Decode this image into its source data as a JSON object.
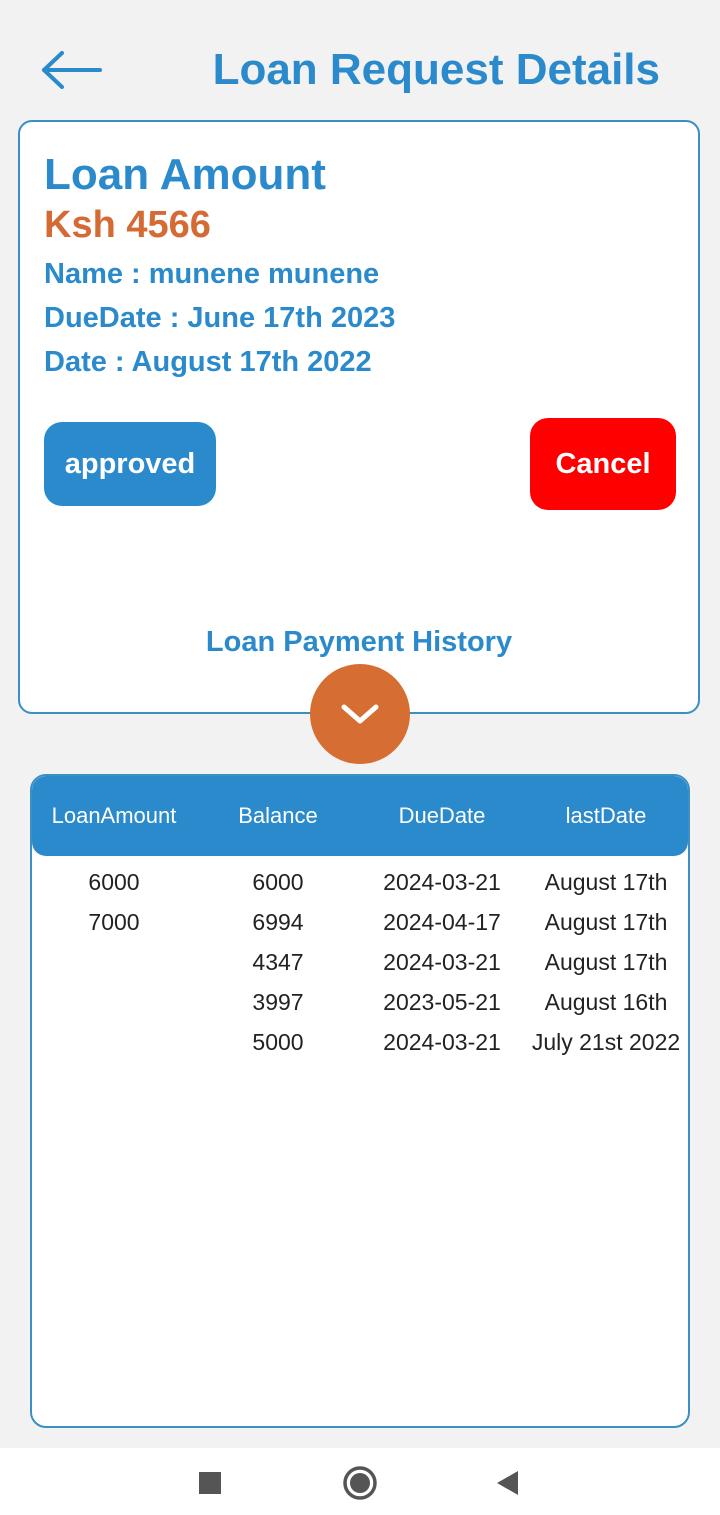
{
  "header": {
    "title": "Loan Request Details",
    "back_icon": "arrow-left-icon",
    "color": "#2a8acb"
  },
  "loan": {
    "heading": "Loan Amount",
    "amount": "Ksh 4566",
    "name_line": "Name : munene munene",
    "due_line": "DueDate : June 17th 2023",
    "date_line": "Date : August 17th 2022",
    "status_label": "approved",
    "cancel_label": "Cancel"
  },
  "history": {
    "title": "Loan Payment History",
    "expand_icon": "chevron-down-icon",
    "columns": [
      "LoanAmount",
      "Balance",
      "DueDate",
      "lastDate"
    ],
    "rows": [
      [
        "6000",
        "6000",
        "2024-03-21",
        "August 17th"
      ],
      [
        "7000",
        "6994",
        "2024-04-17",
        "August 17th"
      ],
      [
        "",
        "4347",
        "2024-03-21",
        "August 17th"
      ],
      [
        "",
        "3997",
        "2023-05-21",
        "August 16th"
      ],
      [
        "",
        "5000",
        "2024-03-21",
        "July 21st 2022"
      ]
    ]
  },
  "nav": {
    "recents_icon": "square-icon",
    "home_icon": "circle-icon",
    "back_icon": "triangle-back-icon"
  },
  "colors": {
    "primary": "#2a8acb",
    "accent": "#d66e34",
    "danger": "#ff0000",
    "background": "#f2f2f2"
  }
}
